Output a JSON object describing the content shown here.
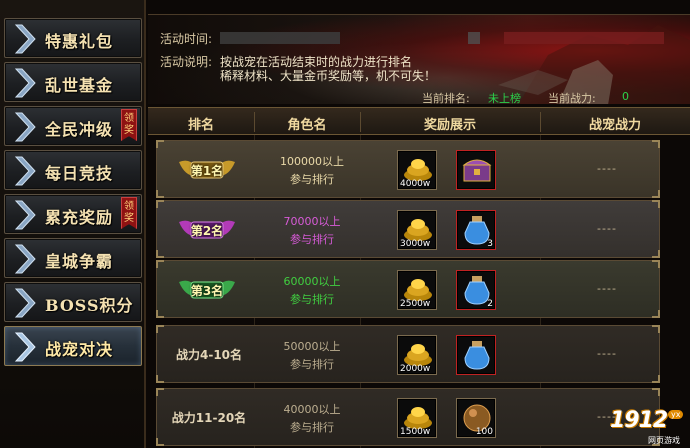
{
  "sidebar": {
    "items": [
      {
        "label": "特惠礼包"
      },
      {
        "label": "乱世基金"
      },
      {
        "label": "全民冲级",
        "badge": "领奖"
      },
      {
        "label": "每日竞技"
      },
      {
        "label": "累充奖励",
        "badge": "领奖"
      },
      {
        "label": "皇城争霸"
      },
      {
        "label": "BOSS积分"
      },
      {
        "label": "战宠对决",
        "active": true
      }
    ]
  },
  "banner": {
    "time_label": "活动时间:",
    "desc_label": "活动说明:",
    "desc_line1": "按战宠在活动结束时的战力进行排名",
    "desc_line2": "稀释材料、大量金币奖励等，机不可失！",
    "current_rank_label": "当前排名:",
    "current_rank_value": "未上榜",
    "current_power_label": "当前战力:",
    "current_power_value": "0"
  },
  "table": {
    "headers": {
      "rank": "排名",
      "role": "角色名",
      "reward": "奖励展示",
      "power": "战宠战力"
    },
    "rows": [
      {
        "style": "gold",
        "rank": "第1名",
        "cond1": "100000以上",
        "cond2": "参与排行",
        "gold": "4000w",
        "item": "chest",
        "item_count": "",
        "power": "----"
      },
      {
        "style": "purple",
        "rank": "第2名",
        "cond1": "70000以上",
        "cond2": "参与排行",
        "gold": "3000w",
        "item": "potion",
        "item_count": "3",
        "power": "----"
      },
      {
        "style": "green",
        "rank": "第3名",
        "cond1": "60000以上",
        "cond2": "参与排行",
        "gold": "2500w",
        "item": "potion",
        "item_count": "2",
        "power": "----"
      },
      {
        "style": "plain",
        "rank": "战力4-10名",
        "cond1": "50000以上",
        "cond2": "参与排行",
        "gold": "2000w",
        "item": "potion",
        "item_count": "",
        "power": "----"
      },
      {
        "style": "plain",
        "rank": "战力11-20名",
        "cond1": "40000以上",
        "cond2": "参与排行",
        "gold": "1500w",
        "item": "orb",
        "item_count": "100",
        "power": "----"
      }
    ]
  },
  "watermark": {
    "number": "1912",
    "badge": "yx",
    "sub": "网页游戏"
  },
  "colors": {
    "accent": "#f0d9a0",
    "green": "#2cd04a",
    "purple": "#d85ad8",
    "badge_red": "#8e1212"
  }
}
